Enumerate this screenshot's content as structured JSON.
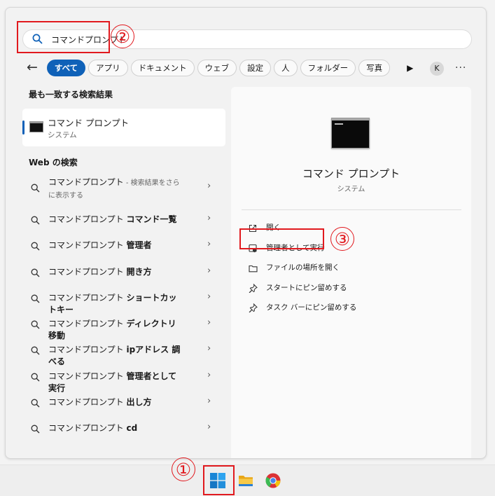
{
  "search": {
    "query": "コマンドプロンプト"
  },
  "annotations": {
    "n1": "①",
    "n2": "②",
    "n3": "③"
  },
  "filters": {
    "chips": [
      "すべて",
      "アプリ",
      "ドキュメント",
      "ウェブ",
      "設定",
      "人",
      "フォルダー",
      "写真"
    ],
    "avatar": "K",
    "more": "···"
  },
  "best_match": {
    "heading": "最も一致する検索結果",
    "title": "コマンド プロンプト",
    "subtitle": "システム"
  },
  "web": {
    "heading": "Web の検索",
    "items": [
      {
        "base": "コマンドプロンプト",
        "bold": "",
        "hint": " - 検索結果をさらに表示する"
      },
      {
        "base": "コマンドプロンプト ",
        "bold": "コマンド一覧",
        "hint": ""
      },
      {
        "base": "コマンドプロンプト ",
        "bold": "管理者",
        "hint": ""
      },
      {
        "base": "コマンドプロンプト ",
        "bold": "開き方",
        "hint": ""
      },
      {
        "base": "コマンドプロンプト ",
        "bold": "ショートカットキー",
        "hint": ""
      },
      {
        "base": "コマンドプロンプト ",
        "bold": "ディレクトリ移動",
        "hint": ""
      },
      {
        "base": "コマンドプロンプト ",
        "bold": "ipアドレス 調べる",
        "hint": ""
      },
      {
        "base": "コマンドプロンプト ",
        "bold": "管理者として実行",
        "hint": ""
      },
      {
        "base": "コマンドプロンプト ",
        "bold": "出し方",
        "hint": ""
      },
      {
        "base": "コマンドプロンプト ",
        "bold": "cd",
        "hint": ""
      }
    ]
  },
  "preview": {
    "title": "コマンド プロンプト",
    "subtitle": "システム",
    "actions": [
      {
        "label": "開く",
        "icon": "open-external-icon"
      },
      {
        "label": "管理者として実行",
        "icon": "shield-icon"
      },
      {
        "label": "ファイルの場所を開く",
        "icon": "folder-icon"
      },
      {
        "label": "スタートにピン留めする",
        "icon": "pin-icon"
      },
      {
        "label": "タスク バーにピン留めする",
        "icon": "pin-icon"
      }
    ]
  },
  "colors": {
    "accent": "#0f61b8",
    "annotation": "#e1191e"
  }
}
